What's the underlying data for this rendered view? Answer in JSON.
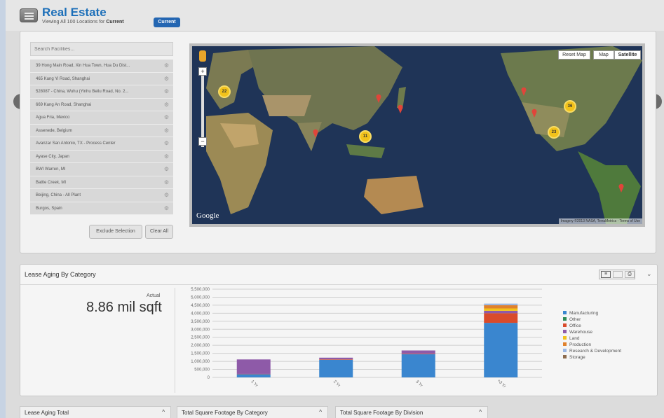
{
  "header": {
    "title": "Real Estate",
    "subtitle_prefix": "Viewing All 100 Locations for",
    "subtitle_bold": "Current",
    "current_button": "Current"
  },
  "locations": {
    "search_placeholder": "Search Facilities...",
    "items": [
      "39 Hong Main Road, Xin Hua Town, Hua Du Dist...",
      "465 Kang Yi Road, Shanghai",
      "528087 - China, Wuhu (Yinhu Beilu Road, No. 2...",
      "669 Kang An Road, Shanghai",
      "Agua Fria, Mexico",
      "Assenede, Belgium",
      "Avanzar San Antonio, TX - Process Center",
      "Ayase City, Japan",
      "BWI Warren, MI",
      "Battle Creek, MI",
      "Beijing, China - All Plant",
      "Burgos, Spain"
    ],
    "exclude_button": "Exclude Selection",
    "clear_button": "Clear All"
  },
  "map": {
    "reset_button": "Reset Map",
    "map_button": "Map",
    "satellite_button": "Satellite",
    "clusters": [
      "22",
      "11",
      "36",
      "23"
    ],
    "google_label": "Google",
    "attribution": "Imagery ©2013 NASA, TerraMetrics - Terms of Use"
  },
  "lease": {
    "title": "Lease Aging By Category",
    "metric_label": "Actual",
    "metric_value": "8.86 mil sqft"
  },
  "chart_data": {
    "type": "bar",
    "stacked": true,
    "categories": [
      "1 Yr",
      "2 Yr",
      "3 Yr",
      "+3 Yr"
    ],
    "yticks": [
      "5,500,000",
      "5,000,000",
      "4,500,000",
      "4,000,000",
      "3,500,000",
      "3,000,000",
      "2,500,000",
      "2,000,000",
      "1,500,000",
      "1,000,000",
      "500,000",
      "0"
    ],
    "ylim": [
      0,
      5500000
    ],
    "series": [
      {
        "name": "Manufacturing",
        "color": "#3a86cf",
        "values": [
          200000,
          1100000,
          1450000,
          3400000
        ]
      },
      {
        "name": "Other",
        "color": "#2e8b57",
        "values": [
          0,
          0,
          0,
          0
        ]
      },
      {
        "name": "Office",
        "color": "#d94b2b",
        "values": [
          20000,
          30000,
          30000,
          600000
        ]
      },
      {
        "name": "Warehouse",
        "color": "#8e5aa8",
        "values": [
          900000,
          100000,
          200000,
          150000
        ]
      },
      {
        "name": "Land",
        "color": "#f2c21a",
        "values": [
          0,
          0,
          0,
          150000
        ]
      },
      {
        "name": "Production",
        "color": "#e0812c",
        "values": [
          0,
          0,
          0,
          200000
        ]
      },
      {
        "name": "Research & Development",
        "color": "#9bb7e4",
        "values": [
          0,
          0,
          0,
          100000
        ]
      },
      {
        "name": "Storage",
        "color": "#8c6b4d",
        "values": [
          0,
          0,
          0,
          0
        ]
      }
    ],
    "legend_position": "right",
    "grid": true
  },
  "bottom_tabs": [
    "Lease Aging Total",
    "Total Square Footage By Category",
    "Total Square Footage By Division"
  ]
}
